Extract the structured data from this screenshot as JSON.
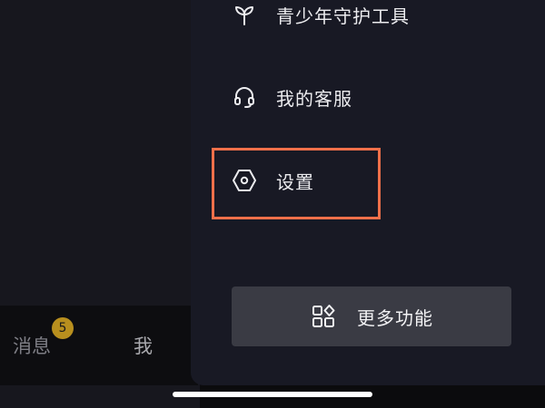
{
  "tabbar": {
    "messages_label": "消息",
    "messages_badge": "5",
    "me_label": "我"
  },
  "drawer": {
    "items": [
      {
        "label": "青少年守护工具",
        "icon": "sprout-icon"
      },
      {
        "label": "我的客服",
        "icon": "headset-icon"
      },
      {
        "label": "设置",
        "icon": "hexagon-settings-icon"
      }
    ],
    "more_button": {
      "label": "更多功能",
      "icon": "apps-grid-icon"
    }
  },
  "colors": {
    "drawer_background": "#181924",
    "highlight_border": "#f0704a",
    "badge": "#b88f1e",
    "more_button_background": "#3a3b44"
  }
}
